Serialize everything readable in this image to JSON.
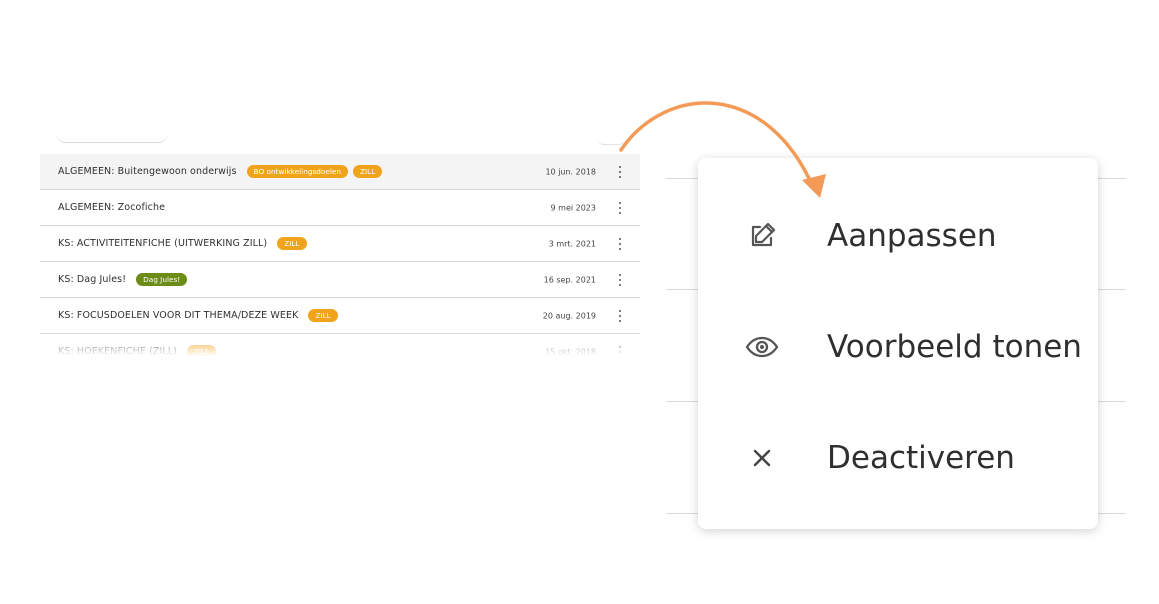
{
  "list": {
    "rows": [
      {
        "title": "ALGEMEEN: Buitengewoon onderwijs",
        "badges": [
          {
            "text": "BO ontwikkelingsdoelen",
            "color": "orange"
          },
          {
            "text": "ZILL",
            "color": "orange"
          }
        ],
        "date": "10 jun. 2018"
      },
      {
        "title": "ALGEMEEN: Zocofiche",
        "badges": [],
        "date": "9 mei 2023"
      },
      {
        "title": "KS: ACTIVITEITENFICHE (UITWERKING ZILL)",
        "badges": [
          {
            "text": "ZILL",
            "color": "orange"
          }
        ],
        "date": "3 mrt. 2021"
      },
      {
        "title": "KS: Dag Jules!",
        "badges": [
          {
            "text": "Dag Jules!",
            "color": "green"
          }
        ],
        "date": "16 sep. 2021"
      },
      {
        "title": "KS: FOCUSDOELEN VOOR DIT THEMA/DEZE WEEK",
        "badges": [
          {
            "text": "ZILL",
            "color": "orange"
          }
        ],
        "date": "20 aug. 2019"
      },
      {
        "title": "KS: HOEKENFICHE (ZILL)",
        "badges": [
          {
            "text": "ZILL",
            "color": "orange"
          }
        ],
        "date": "15 okt. 2018"
      }
    ]
  },
  "menu": {
    "items": [
      {
        "label": "Aanpassen",
        "icon": "edit-icon"
      },
      {
        "label": "Voorbeeld tonen",
        "icon": "eye-icon"
      },
      {
        "label": "Deactiveren",
        "icon": "close-icon"
      }
    ]
  },
  "colors": {
    "badge_orange": "#f2a31c",
    "badge_green": "#6c8b17",
    "arrow": "#f39a57"
  }
}
